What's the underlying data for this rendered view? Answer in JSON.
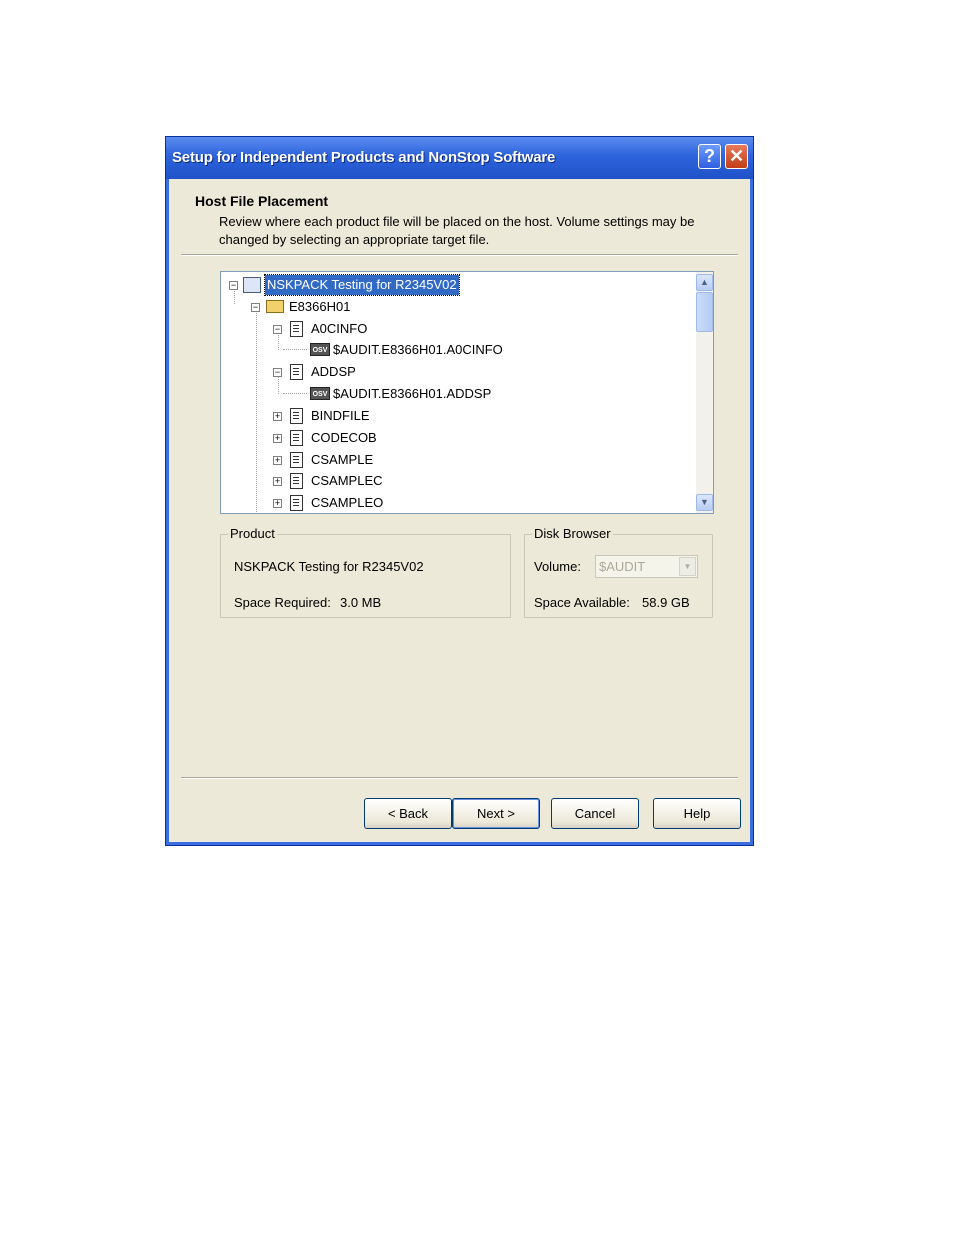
{
  "window": {
    "title": "Setup for Independent Products and NonStop Software",
    "help_icon": "help-icon",
    "help_glyph": "?",
    "close_icon": "close-icon",
    "close_glyph": "✕"
  },
  "header": {
    "title": "Host File Placement",
    "description": "Review where each product file will be placed on the host.  Volume settings may be changed by selecting an appropriate target file."
  },
  "tree": {
    "nodes": [
      {
        "label": "NSKPACK Testing for  R2345V02",
        "icon": "product-icon",
        "expander": "minus",
        "selected": true
      },
      {
        "label": "E8366H01",
        "icon": "open-folder-icon",
        "expander": "minus"
      },
      {
        "label": "A0CINFO",
        "icon": "document-icon",
        "expander": "minus"
      },
      {
        "label": "$AUDIT.E8366H01.A0CINFO",
        "icon": "osv-volume-icon"
      },
      {
        "label": "ADDSP",
        "icon": "document-icon",
        "expander": "minus"
      },
      {
        "label": "$AUDIT.E8366H01.ADDSP",
        "icon": "osv-volume-icon"
      },
      {
        "label": "BINDFILE",
        "icon": "document-icon",
        "expander": "plus"
      },
      {
        "label": "CODECOB",
        "icon": "document-icon",
        "expander": "plus"
      },
      {
        "label": "CSAMPLE",
        "icon": "document-icon",
        "expander": "plus"
      },
      {
        "label": "CSAMPLEC",
        "icon": "document-icon",
        "expander": "plus"
      },
      {
        "label": "CSAMPLEO",
        "icon": "document-icon",
        "expander": "plus"
      }
    ],
    "osv_text": "OSV",
    "minus_glyph": "−",
    "plus_glyph": "+",
    "scroll_up_glyph": "▲",
    "scroll_down_glyph": "▼"
  },
  "product_group": {
    "label": "Product",
    "name": "NSKPACK Testing for  R2345V02",
    "space_label": "Space Required:",
    "space_value": "3.0 MB"
  },
  "disk_group": {
    "label": "Disk Browser",
    "volume_label": "Volume:",
    "volume_value": "$AUDIT",
    "dropdown_glyph": "▼",
    "space_label": "Space Available:",
    "space_value": "58.9 GB"
  },
  "buttons": {
    "back": "< Back",
    "next": "Next >",
    "cancel": "Cancel",
    "help": "Help"
  },
  "colors": {
    "title_bar": "#2d63dc",
    "dialog_bg": "#ece9d8",
    "selection": "#316ac5"
  }
}
